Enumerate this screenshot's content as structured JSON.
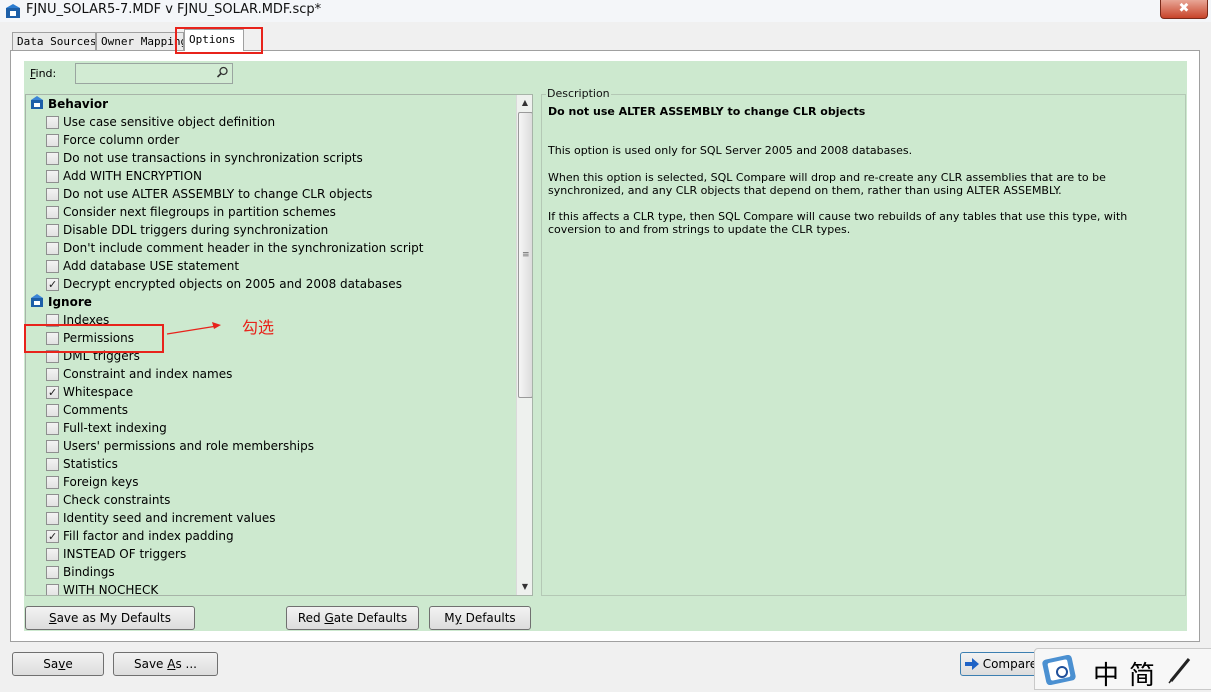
{
  "window": {
    "title": "FJNU_SOLAR5-7.MDF v FJNU_SOLAR.MDF.scp*",
    "close_glyph": "✖"
  },
  "tabs": [
    {
      "label": "Data Sources",
      "active": false
    },
    {
      "label": "Owner Mapping",
      "active": false
    },
    {
      "label": "Options",
      "active": true
    }
  ],
  "find": {
    "label_access_key": "F",
    "label_rest": "ind:",
    "value": ""
  },
  "groups": {
    "behavior": {
      "label": "Behavior",
      "items": [
        {
          "label": "Use case sensitive object definition",
          "checked": false
        },
        {
          "label": "Force column order",
          "checked": false
        },
        {
          "label": "Do not use transactions in synchronization scripts",
          "checked": false
        },
        {
          "label": "Add WITH ENCRYPTION",
          "checked": false
        },
        {
          "label": "Do not use ALTER ASSEMBLY to change CLR objects",
          "checked": false
        },
        {
          "label": "Consider next filegroups in partition schemes",
          "checked": false
        },
        {
          "label": "Disable DDL triggers during synchronization",
          "checked": false
        },
        {
          "label": "Don't include comment header in the synchronization script",
          "checked": false
        },
        {
          "label": "Add database USE statement",
          "checked": false
        },
        {
          "label": "Decrypt encrypted objects on 2005 and 2008 databases",
          "checked": true
        }
      ]
    },
    "ignore": {
      "label": "Ignore",
      "items": [
        {
          "label": "Indexes",
          "checked": false
        },
        {
          "label": "Permissions",
          "checked": false
        },
        {
          "label": "DML triggers",
          "checked": false
        },
        {
          "label": "Constraint and index names",
          "checked": false
        },
        {
          "label": "Whitespace",
          "checked": true
        },
        {
          "label": "Comments",
          "checked": false
        },
        {
          "label": "Full-text indexing",
          "checked": false
        },
        {
          "label": "Users' permissions and role memberships",
          "checked": false
        },
        {
          "label": "Statistics",
          "checked": false
        },
        {
          "label": "Foreign keys",
          "checked": false
        },
        {
          "label": "Check constraints",
          "checked": false
        },
        {
          "label": "Identity seed and increment values",
          "checked": false
        },
        {
          "label": "Fill factor and index padding",
          "checked": true
        },
        {
          "label": "INSTEAD OF triggers",
          "checked": false
        },
        {
          "label": "Bindings",
          "checked": false
        },
        {
          "label": "WITH NOCHECK",
          "checked": false
        }
      ]
    }
  },
  "description": {
    "legend": "Description",
    "title": "Do not use ALTER ASSEMBLY to change CLR objects",
    "paragraphs": [
      "This option is used only for SQL Server 2005 and 2008 databases.",
      "When this option is selected, SQL Compare will drop and re-create any CLR assemblies that are to be synchronized, and any CLR objects that depend on them, rather than using ALTER ASSEMBLY.",
      "If this affects a CLR type, then SQL Compare will cause two rebuilds of any tables that use this type, with coversion to and from strings to update the CLR types."
    ]
  },
  "buttons": {
    "save_as_my_defaults": {
      "key": "S",
      "rest": "ave as My Defaults"
    },
    "red_gate_defaults": {
      "pre": "Red ",
      "key": "G",
      "rest": "ate Defaults"
    },
    "my_defaults": {
      "pre": "M",
      "key": "y",
      "rest": " Defaults"
    },
    "save": {
      "pre": "Sa",
      "key": "v",
      "rest": "e"
    },
    "save_as": {
      "pre": "Save ",
      "key": "A",
      "rest": "s ..."
    },
    "compare": {
      "label": "Compare"
    }
  },
  "annotation": {
    "text": "勾选",
    "color": "#e8231b"
  },
  "ime": {
    "char1": "中",
    "char2": "简"
  },
  "colors": {
    "panel_green": "#cde9cf",
    "annotation_red": "#e8231b"
  }
}
